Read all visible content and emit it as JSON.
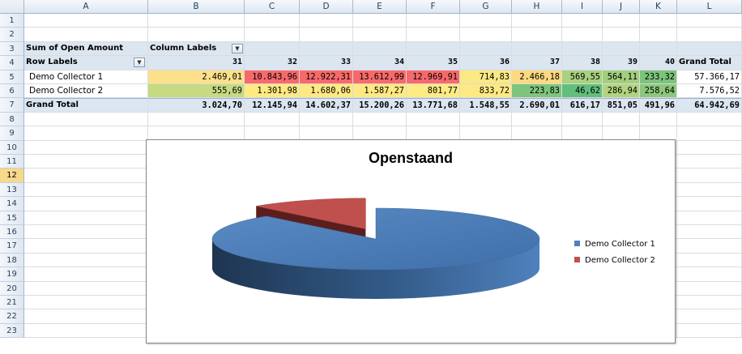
{
  "columns": [
    "A",
    "B",
    "C",
    "D",
    "E",
    "F",
    "G",
    "H",
    "I",
    "J",
    "K",
    "L"
  ],
  "rows": [
    "1",
    "2",
    "3",
    "4",
    "5",
    "6",
    "7",
    "8",
    "9",
    "10",
    "11",
    "12",
    "13",
    "14",
    "15",
    "16",
    "17",
    "18",
    "19",
    "20",
    "21",
    "22",
    "23"
  ],
  "selected_row": "12",
  "pivot": {
    "values_label": "Sum of Open Amount",
    "column_labels": "Column Labels",
    "row_labels": "Row Labels",
    "week_headers": [
      "31",
      "32",
      "33",
      "34",
      "35",
      "36",
      "37",
      "38",
      "39",
      "40"
    ],
    "grand_total_col": "Grand Total",
    "grand_total_row": "Grand Total",
    "dropdown_glyph": "▼",
    "rows": [
      {
        "name": "Demo Collector 1",
        "values": [
          "2.469,01",
          "10.843,96",
          "12.922,31",
          "13.612,99",
          "12.969,91",
          "714,83",
          "2.466,18",
          "569,55",
          "564,11",
          "233,32"
        ],
        "total": "57.366,17",
        "colors": [
          "#fde08a",
          "#f8696b",
          "#f8696b",
          "#f8696b",
          "#f8696b",
          "#fbe983",
          "#fdd981",
          "#a8d27f",
          "#a2cf7e",
          "#7cc37b"
        ]
      },
      {
        "name": "Demo Collector 2",
        "values": [
          "555,69",
          "1.301,98",
          "1.680,06",
          "1.587,27",
          "801,77",
          "833,72",
          "223,83",
          "46,62",
          "286,94",
          "258,64"
        ],
        "total": "7.576,52",
        "colors": [
          "#c5da81",
          "#fee983",
          "#fee983",
          "#fee983",
          "#ffeb84",
          "#fee983",
          "#7fc47c",
          "#63be7b",
          "#b2d47f",
          "#8cc77d"
        ]
      }
    ],
    "grand_totals": [
      "3.024,70",
      "12.145,94",
      "14.602,37",
      "15.200,26",
      "13.771,68",
      "1.548,55",
      "2.690,01",
      "616,17",
      "851,05",
      "491,96"
    ],
    "grand_total_all": "64.942,69"
  },
  "chart_data": {
    "type": "pie",
    "title": "Openstaand",
    "labels": [
      "Demo Collector 1",
      "Demo Collector 2"
    ],
    "values": [
      57366.17,
      7576.52
    ],
    "colors": [
      "#4f81bd",
      "#c0504d"
    ],
    "legend": "right",
    "exploded": true,
    "three_d": true
  }
}
